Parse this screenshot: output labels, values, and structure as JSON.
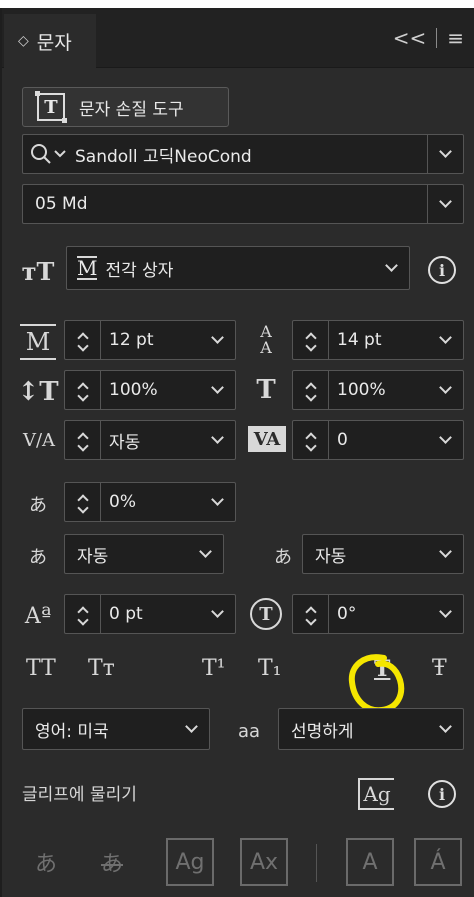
{
  "panel": {
    "tab_label": "문자",
    "collapse_glyph": "<<",
    "menu_glyph": "≡"
  },
  "touch_tool": {
    "label": "문자 손질 도구"
  },
  "font": {
    "family": "Sandoll 고딕NeoCond",
    "style": "05 Md"
  },
  "size_mode": {
    "value": "전각 상자"
  },
  "metrics": {
    "font_size": "12 pt",
    "leading": "14 pt",
    "vertical_scale": "100%",
    "horizontal_scale": "100%",
    "kerning": "자동",
    "tracking": "0",
    "tsume": "0%",
    "aki_left": "자동",
    "aki_right": "자동",
    "baseline_shift": "0 pt",
    "rotation": "0°"
  },
  "language": {
    "value": "영어: 미국",
    "antialias": "선명하게"
  },
  "snap": {
    "label": "글리프에 물리기"
  },
  "icons": {
    "kerning_glyph": "V/A",
    "tracking_glyph": "VA",
    "tsume_glyph": "あ",
    "antialias_glyph": "aa",
    "glyph_snap_glyph": "Ag",
    "bottom": [
      "あ",
      "あ",
      "Ag",
      "Ax",
      "A",
      "Á"
    ]
  },
  "styles": [
    "TT",
    "Tт",
    "T¹",
    "T₁",
    "T",
    "Ŧ"
  ],
  "colors": {
    "panel_bg": "#2b2b2b",
    "field_bg": "#1f1f1f",
    "highlight": "#f5e600"
  }
}
